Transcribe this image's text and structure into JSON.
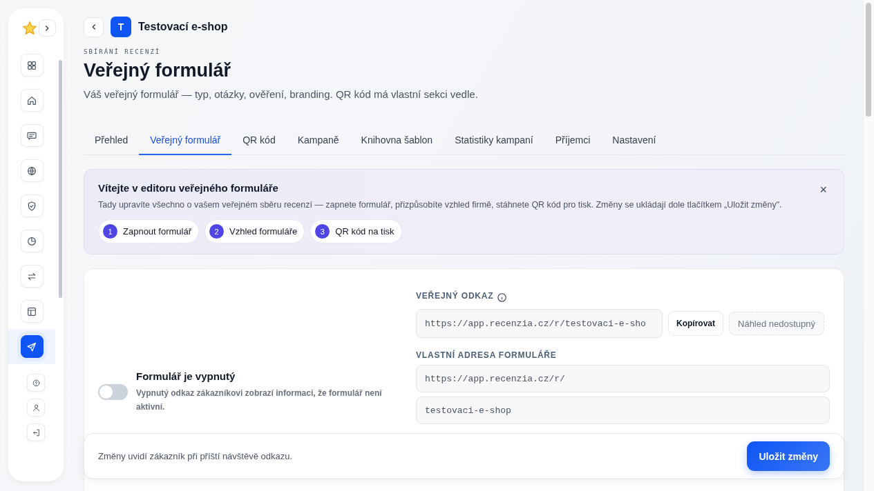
{
  "sidebar": {
    "nav": [
      {
        "kind": "grid",
        "selected": false
      },
      {
        "kind": "home",
        "selected": false
      },
      {
        "kind": "message",
        "selected": false
      },
      {
        "kind": "globe",
        "selected": false
      },
      {
        "kind": "shield",
        "selected": false
      },
      {
        "kind": "chart",
        "selected": false
      },
      {
        "kind": "transfer",
        "selected": false
      },
      {
        "kind": "layout",
        "selected": false
      },
      {
        "kind": "send",
        "selected": true
      }
    ],
    "bottom": [
      {
        "kind": "help"
      },
      {
        "kind": "user"
      },
      {
        "kind": "logout"
      }
    ]
  },
  "header": {
    "shop_initial": "T",
    "shop_name": "Testovací e-shop"
  },
  "page": {
    "eyebrow": "SBÍRÁNÍ RECENZÍ",
    "title": "Veřejný formulář",
    "subtitle": "Váš veřejný formulář — typ, otázky, ověření, branding. QR kód má vlastní sekci vedle."
  },
  "tabs": [
    {
      "label": "Přehled",
      "selected": false
    },
    {
      "label": "Veřejný formulář",
      "selected": true
    },
    {
      "label": "QR kód",
      "selected": false
    },
    {
      "label": "Kampaně",
      "selected": false
    },
    {
      "label": "Knihovna šablon",
      "selected": false
    },
    {
      "label": "Statistiky kampaní",
      "selected": false
    },
    {
      "label": "Příjemci",
      "selected": false
    },
    {
      "label": "Nastavení",
      "selected": false
    }
  ],
  "welcome": {
    "title": "Vítejte v editoru veřejného formuláře",
    "text": "Tady upravíte všechno o vašem veřejném sběru recenzí — zapnete formulář, přizpůsobíte vzhled firmě, stáhnete QR kód pro tisk. Změny se ukládají dole tlačítkem „Uložit změny\".",
    "close": "×",
    "steps": [
      {
        "number": "1",
        "label": "Zapnout formulář"
      },
      {
        "number": "2",
        "label": "Vzhled formuláře"
      },
      {
        "number": "3",
        "label": "QR kód na tisk"
      }
    ]
  },
  "form": {
    "toggle": {
      "on": false
    },
    "status_title": "Formulář je vypnutý",
    "status_text": "Vypnutý odkaz zákazníkovi zobrazí informaci, že formulář není aktivní.",
    "public_link": {
      "label": "VEŘEJNÝ ODKAZ",
      "value": "https://app.recenzia.cz/r/testovaci-e-sho",
      "copy_button": "Kopírovat",
      "preview_button": "Náhled nedostupný"
    },
    "custom_address": {
      "label": "VLASTNÍ ADRESA FORMULÁŘE",
      "prefix": "https://app.recenzia.cz/r/",
      "slug": "testovaci-e-shop"
    }
  },
  "save_bar": {
    "note": "Změny uvidí zákazník při příští návštěvě odkazu.",
    "button": "Uložit změny"
  }
}
